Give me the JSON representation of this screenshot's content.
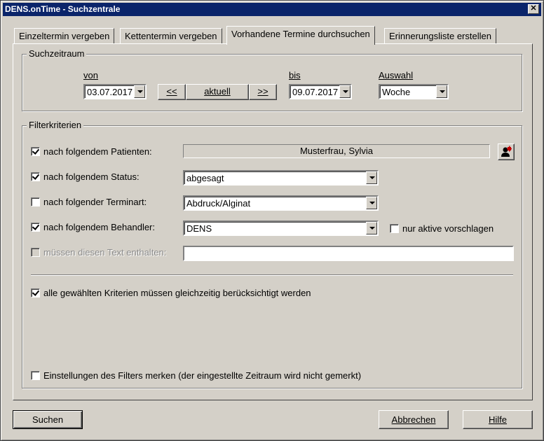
{
  "window": {
    "title": "DENS.onTime - Suchzentrale",
    "close_glyph": "✕"
  },
  "tabs": [
    {
      "label": "Einzeltermin vergeben",
      "active": false
    },
    {
      "label": "Kettentermin vergeben",
      "active": false
    },
    {
      "label": "Vorhandene Termine durchsuchen",
      "active": true
    },
    {
      "label": "Erinnerungsliste erstellen",
      "active": false
    }
  ],
  "suchzeitraum": {
    "legend": "Suchzeitraum",
    "von_label": "von",
    "von_value": "03.07.2017",
    "prev_label": "<<",
    "aktuell_label": "aktuell",
    "next_label": ">>",
    "bis_label": "bis",
    "bis_value": "09.07.2017",
    "auswahl_label": "Auswahl",
    "auswahl_value": "Woche"
  },
  "filter": {
    "legend": "Filterkriterien",
    "patient": {
      "label": "nach folgendem Patienten:",
      "checked": true,
      "value": "Musterfrau, Sylvia",
      "icon": "patient-lookup-icon"
    },
    "status": {
      "label": "nach folgendem Status:",
      "checked": true,
      "value": "abgesagt"
    },
    "terminart": {
      "label": "nach folgender Terminart:",
      "checked": false,
      "value": "Abdruck/Alginat"
    },
    "behandler": {
      "label": "nach folgendem Behandler:",
      "checked": true,
      "value": "DENS"
    },
    "nur_aktive": {
      "label": "nur aktive vorschlagen",
      "checked": false
    },
    "text": {
      "label": "müssen diesen Text enthalten:",
      "checked": false,
      "disabled": true,
      "value": ""
    },
    "alle_kriterien": {
      "label": "alle gewählten Kriterien müssen gleichzeitig berücksichtigt werden",
      "checked": true
    },
    "merken": {
      "label": "Einstellungen des Filters merken (der eingestellte Zeitraum wird nicht gemerkt)",
      "checked": false
    }
  },
  "buttons": {
    "suchen": "Suchen",
    "abbrechen": "Abbrechen",
    "hilfe": "Hilfe"
  },
  "colors": {
    "titlebar": "#0a246a",
    "face": "#d4d0c8"
  }
}
